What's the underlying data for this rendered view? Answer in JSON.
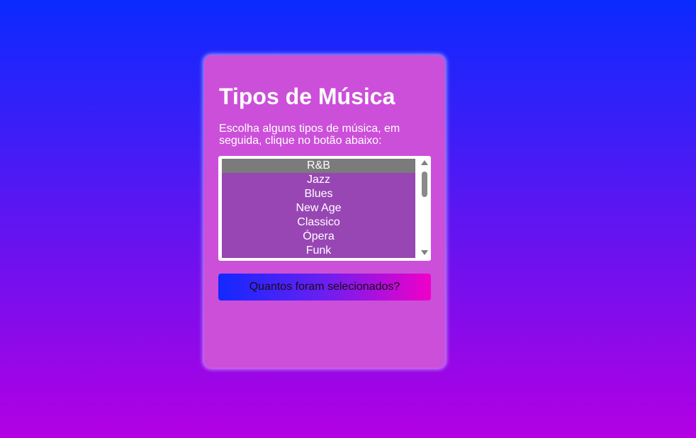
{
  "card": {
    "title": "Tipos de Música",
    "instructions": "Escolha alguns tipos de música, em seguida, clique no botão abaixo:"
  },
  "listbox": {
    "options": [
      {
        "label": "R&B",
        "selected": true
      },
      {
        "label": "Jazz",
        "selected": false
      },
      {
        "label": "Blues",
        "selected": false
      },
      {
        "label": "New Age",
        "selected": false
      },
      {
        "label": "Classico",
        "selected": false
      },
      {
        "label": "Ópera",
        "selected": false
      },
      {
        "label": "Funk",
        "selected": false
      }
    ]
  },
  "button": {
    "label": "Quantos foram selecionados?"
  },
  "colors": {
    "background_top": "#0a2aff",
    "background_bottom": "#b300e3",
    "card": "#cc4fd9",
    "option": "#9846b4",
    "option_selected": "#7b7b7b"
  },
  "icons": {
    "scroll_up": "scroll-up-arrow-icon",
    "scroll_down": "scroll-down-arrow-icon"
  }
}
